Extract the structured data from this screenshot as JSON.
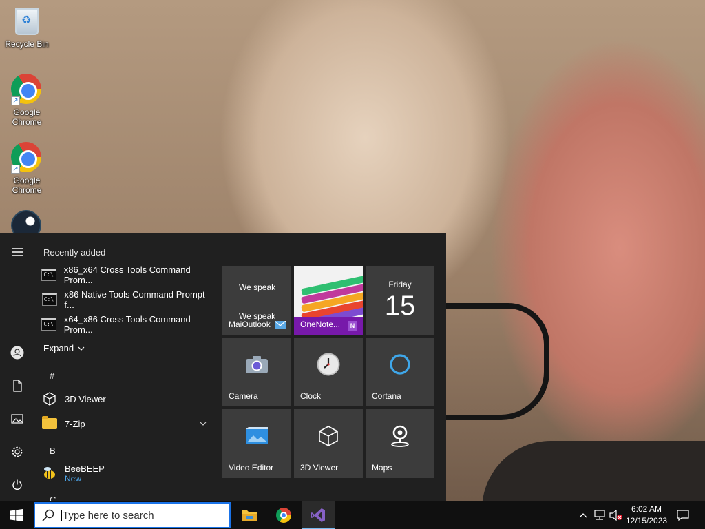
{
  "desktop": {
    "icons": [
      {
        "label": "Recycle Bin"
      },
      {
        "label": "Google Chrome"
      },
      {
        "label": "Google Chrome"
      }
    ]
  },
  "start_menu": {
    "recently_added_heading": "Recently added",
    "recent_items": [
      {
        "label": "x86_x64 Cross Tools Command Prom..."
      },
      {
        "label": "x86 Native Tools Command Prompt f..."
      },
      {
        "label": "x64_x86 Cross Tools Command Prom..."
      }
    ],
    "expand_label": "Expand",
    "groups": {
      "hash": "#",
      "b": "B",
      "c": "C"
    },
    "apps": {
      "viewer3d": "3D Viewer",
      "zip7": "7-Zip",
      "beebeep": "BeeBEEP",
      "beebeep_badge": "New"
    },
    "tiles": {
      "mail_line1": "We speak",
      "mail_line2": "We speak",
      "mail_label": "MaiOutlook",
      "onenote_label": "OneNote...",
      "calendar_day": "Friday",
      "calendar_date": "15",
      "camera": "Camera",
      "clock": "Clock",
      "cortana": "Cortana",
      "video_editor": "Video Editor",
      "viewer3d": "3D Viewer",
      "maps": "Maps"
    }
  },
  "taskbar": {
    "search_placeholder": "Type here to search",
    "time": "6:02 AM",
    "date": "12/15/2023"
  },
  "colors": {
    "start_bg": "#202020",
    "tile_bg": "#3c3c3c",
    "onenote": "#7719aa",
    "accent": "#1a73e8",
    "badge_new": "#4ea5e8"
  }
}
